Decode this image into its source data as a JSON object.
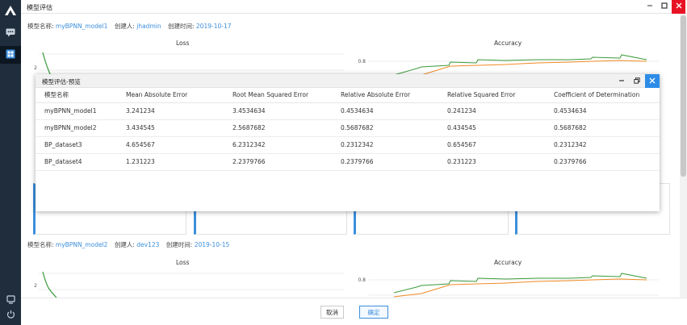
{
  "window": {
    "title": "模型评估"
  },
  "section1": {
    "name_label": "模型名称:",
    "name_value": "myBPNN_model1",
    "creator_label": "创建人:",
    "creator_value": "jhadmin",
    "time_label": "创建时间:",
    "time_value": "2019-10-17",
    "loss_title": "Loss",
    "accuracy_title": "Accuracy",
    "loss_tick": "2",
    "acc_tick": "0.8"
  },
  "section2": {
    "name_label": "模型名称:",
    "name_value": "myBPNN_model2",
    "creator_label": "创建人:",
    "creator_value": "dev123",
    "time_label": "创建时间:",
    "time_value": "2019-10-15",
    "loss_title": "Loss",
    "accuracy_title": "Accuracy",
    "loss_tick": "2",
    "acc_tick": "0.8"
  },
  "modal": {
    "title": "模型评估-预览",
    "columns": [
      "模型名称",
      "Mean Absolute Error",
      "Root Mean Squared Error",
      "Relative Absolute Error",
      "Relative Squared Error",
      "Coefficient of Determination"
    ],
    "rows": [
      [
        "myBPNN_model1",
        "3.241234",
        "3.4534634",
        "0.4534634",
        "0.241234",
        "0.4534634"
      ],
      [
        "myBPNN_model2",
        "3.434545",
        "2.5687682",
        "0.5687682",
        "0.434545",
        "0.5687682"
      ],
      [
        "BP_dataset3",
        "4.654567",
        "6.2312342",
        "0.2312342",
        "0.654567",
        "0.2312342"
      ],
      [
        "BP_dataset4",
        "1.231223",
        "2.2379766",
        "0.2379766",
        "0.231223",
        "0.2379766"
      ]
    ]
  },
  "footer": {
    "cancel_label": "取消",
    "confirm_label": "确定"
  },
  "colors": {
    "accent": "#3c8fdc",
    "sidebar": "#1f2d3d",
    "train_line": "#3a9a3a",
    "val_line": "#f08a24",
    "close_red": "#e81123"
  },
  "icons": {
    "logo": "logo-icon",
    "chat": "chat-icon",
    "dashboard": "dashboard-icon",
    "monitor": "monitor-icon",
    "power": "power-icon"
  }
}
